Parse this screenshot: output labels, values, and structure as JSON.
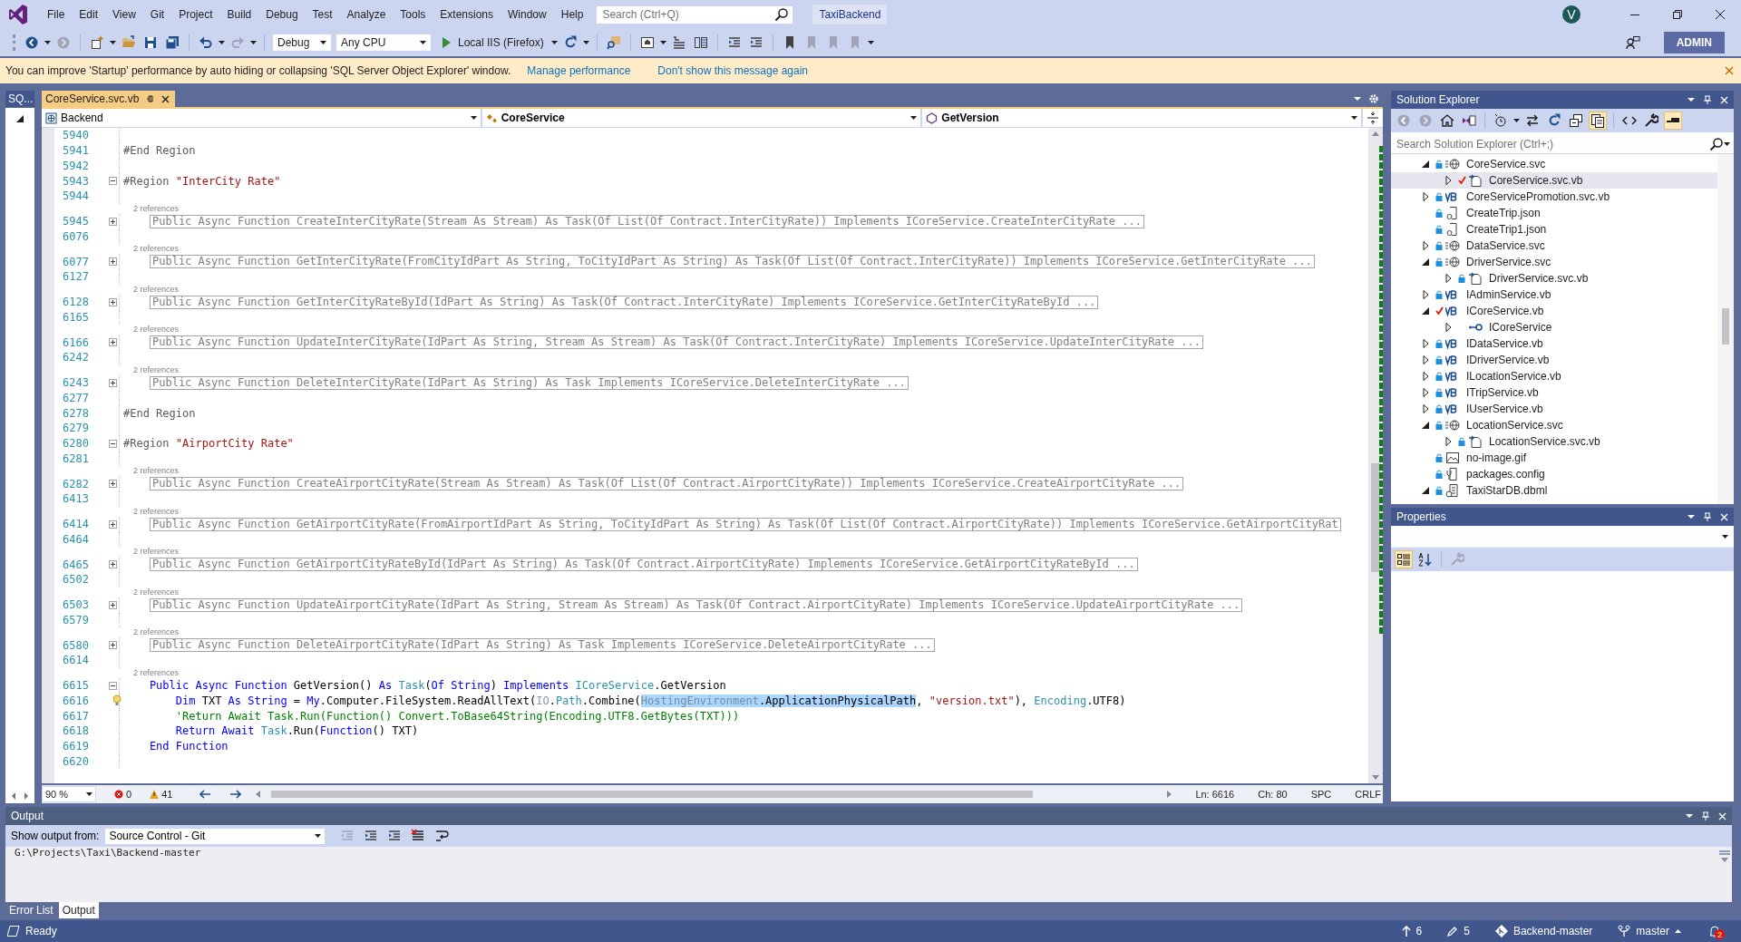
{
  "menu_bar": {
    "items": [
      "File",
      "Edit",
      "View",
      "Git",
      "Project",
      "Build",
      "Debug",
      "Test",
      "Analyze",
      "Tools",
      "Extensions",
      "Window",
      "Help"
    ],
    "search": {
      "placeholder": "Search (Ctrl+Q)"
    },
    "solution_name": "TaxiBackend",
    "account_initial": "V"
  },
  "toolbar": {
    "configuration": "Debug",
    "platform": "Any CPU",
    "run_target": "Local IIS (Firefox)",
    "account_button": "ADMIN"
  },
  "info_bar": {
    "message": "You can improve 'Startup' performance by auto hiding or collapsing 'SQL Server Object Explorer' window.",
    "links": [
      "Manage performance",
      "Don't show this message again"
    ]
  },
  "side_tab": {
    "label": "SQ..."
  },
  "document_tabs": [
    {
      "label": "CoreService.svc.vb",
      "selected": true
    }
  ],
  "navigation_bar": {
    "project": "Backend",
    "type": "CoreService",
    "member": "GetVersion"
  },
  "editor": {
    "lines": [
      {
        "number": "5940",
        "kind": "blank"
      },
      {
        "number": "5941",
        "kind": "code",
        "tokens": [
          {
            "text": "#End Region",
            "kind": "directive"
          }
        ]
      },
      {
        "number": "5942",
        "kind": "blank"
      },
      {
        "number": "5943",
        "kind": "code",
        "expanded": true,
        "tokens": [
          {
            "text": "#Region ",
            "kind": "directive"
          },
          {
            "text": "\"InterCity Rate\"",
            "kind": "string"
          }
        ]
      },
      {
        "number": "5944",
        "kind": "blank"
      },
      {
        "number": "5945",
        "kind": "collapsed",
        "expanded": false,
        "lens": "2 references",
        "text": "Public Async Function CreateInterCityRate(Stream As Stream) As Task(Of List(Of Contract.InterCityRate)) Implements ICoreService.CreateInterCityRate ..."
      },
      {
        "number": "6076",
        "kind": "blank"
      },
      {
        "number": "6077",
        "kind": "collapsed",
        "expanded": false,
        "lens": "2 references",
        "text": "Public Async Function GetInterCityRate(FromCityIdPart As String, ToCityIdPart As String) As Task(Of List(Of Contract.InterCityRate)) Implements ICoreService.GetInterCityRate ..."
      },
      {
        "number": "6127",
        "kind": "blank"
      },
      {
        "number": "6128",
        "kind": "collapsed",
        "expanded": false,
        "lens": "2 references",
        "text": "Public Async Function GetInterCityRateById(IdPart As String) As Task(Of Contract.InterCityRate) Implements ICoreService.GetInterCityRateById ..."
      },
      {
        "number": "6165",
        "kind": "blank"
      },
      {
        "number": "6166",
        "kind": "collapsed",
        "expanded": false,
        "lens": "2 references",
        "text": "Public Async Function UpdateInterCityRate(IdPart As String, Stream As Stream) As Task(Of Contract.InterCityRate) Implements ICoreService.UpdateInterCityRate ..."
      },
      {
        "number": "6242",
        "kind": "blank"
      },
      {
        "number": "6243",
        "kind": "collapsed",
        "expanded": false,
        "lens": "2 references",
        "text": "Public Async Function DeleteInterCityRate(IdPart As String) As Task Implements ICoreService.DeleteInterCityRate ..."
      },
      {
        "number": "6277",
        "kind": "blank"
      },
      {
        "number": "6278",
        "kind": "code",
        "tokens": [
          {
            "text": "#End Region",
            "kind": "directive"
          }
        ]
      },
      {
        "number": "6279",
        "kind": "blank"
      },
      {
        "number": "6280",
        "kind": "code",
        "expanded": true,
        "tokens": [
          {
            "text": "#Region ",
            "kind": "directive"
          },
          {
            "text": "\"AirportCity Rate\"",
            "kind": "string"
          }
        ]
      },
      {
        "number": "6281",
        "kind": "blank"
      },
      {
        "number": "6282",
        "kind": "collapsed",
        "expanded": false,
        "lens": "2 references",
        "text": "Public Async Function CreateAirportCityRate(Stream As Stream) As Task(Of List(Of Contract.AirportCityRate)) Implements ICoreService.CreateAirportCityRate ..."
      },
      {
        "number": "6413",
        "kind": "blank"
      },
      {
        "number": "6414",
        "kind": "collapsed",
        "expanded": false,
        "lens": "2 references",
        "text": "Public Async Function GetAirportCityRate(FromAirportIdPart As String, ToCityIdPart As String) As Task(Of List(Of Contract.AirportCityRate)) Implements ICoreService.GetAirportCityRat"
      },
      {
        "number": "6464",
        "kind": "blank"
      },
      {
        "number": "6465",
        "kind": "collapsed",
        "expanded": false,
        "lens": "2 references",
        "text": "Public Async Function GetAirportCityRateById(IdPart As String) As Task(Of Contract.AirportCityRate) Implements ICoreService.GetAirportCityRateById ..."
      },
      {
        "number": "6502",
        "kind": "blank"
      },
      {
        "number": "6503",
        "kind": "collapsed",
        "expanded": false,
        "lens": "2 references",
        "text": "Public Async Function UpdateAirportCityRate(IdPart As String, Stream As Stream) As Task(Of Contract.AirportCityRate) Implements ICoreService.UpdateAirportCityRate ..."
      },
      {
        "number": "6579",
        "kind": "blank"
      },
      {
        "number": "6580",
        "kind": "collapsed",
        "expanded": false,
        "lens": "2 references",
        "text": "Public Async Function DeleteAirportCityRate(IdPart As String) As Task Implements ICoreService.DeleteAirportCityRate ..."
      },
      {
        "number": "6614",
        "kind": "blank"
      },
      {
        "number": "6615",
        "kind": "code",
        "expanded": true,
        "lens": "2 references",
        "tokens": [
          {
            "text": "    Public Async Function",
            "kind": "keyword"
          },
          {
            "text": " GetVersion() ",
            "kind": "plain"
          },
          {
            "text": "As ",
            "kind": "keyword"
          },
          {
            "text": "Task",
            "kind": "type"
          },
          {
            "text": "(",
            "kind": "plain"
          },
          {
            "text": "Of String",
            "kind": "keyword"
          },
          {
            "text": ") ",
            "kind": "plain"
          },
          {
            "text": "Implements ",
            "kind": "keyword"
          },
          {
            "text": "ICoreService",
            "kind": "type"
          },
          {
            "text": ".GetVersion",
            "kind": "plain"
          }
        ]
      },
      {
        "number": "6616",
        "kind": "code",
        "lightbulb": true,
        "tokens": [
          {
            "text": "        Dim",
            "kind": "keyword"
          },
          {
            "text": " TXT ",
            "kind": "plain"
          },
          {
            "text": "As String",
            "kind": "keyword"
          },
          {
            "text": " = ",
            "kind": "plain"
          },
          {
            "text": "My",
            "kind": "keyword"
          },
          {
            "text": ".Computer.FileSystem.ReadAllText(",
            "kind": "plain"
          },
          {
            "text": "IO",
            "kind": "dim"
          },
          {
            "text": ".",
            "kind": "plain"
          },
          {
            "text": "Path",
            "kind": "type"
          },
          {
            "text": ".Combine(",
            "kind": "plain"
          },
          {
            "text": "HostingEnvironment",
            "kind": "selected-dim"
          },
          {
            "text": ".ApplicationPhysicalPath",
            "kind": "selected-plain"
          },
          {
            "text": ", ",
            "kind": "plain"
          },
          {
            "text": "\"version.txt\"",
            "kind": "string"
          },
          {
            "text": "), ",
            "kind": "plain"
          },
          {
            "text": "Encoding",
            "kind": "type"
          },
          {
            "text": ".UTF8)",
            "kind": "plain"
          }
        ]
      },
      {
        "number": "6617",
        "kind": "code",
        "tokens": [
          {
            "text": "        'Return Await Task.Run(Function() Convert.ToBase64String(Encoding.UTF8.GetBytes(TXT)))",
            "kind": "comment"
          }
        ]
      },
      {
        "number": "6618",
        "kind": "code",
        "tokens": [
          {
            "text": "        Return Await ",
            "kind": "keyword"
          },
          {
            "text": "Task",
            "kind": "type"
          },
          {
            "text": ".Run(",
            "kind": "plain"
          },
          {
            "text": "Function",
            "kind": "keyword"
          },
          {
            "text": "() TXT)",
            "kind": "plain"
          }
        ]
      },
      {
        "number": "6619",
        "kind": "code",
        "tokens": [
          {
            "text": "    End Function",
            "kind": "keyword"
          }
        ]
      },
      {
        "number": "6620",
        "kind": "blank"
      }
    ]
  },
  "editor_status": {
    "zoom": "90 %",
    "errors": "0",
    "warnings": "41",
    "line": "Ln: 6616",
    "column": "Ch: 80",
    "whitespace": "SPC",
    "line_ending": "CRLF"
  },
  "solution_explorer": {
    "title": "Solution Explorer",
    "search": {
      "placeholder": "Search Solution Explorer (Ctrl+;)"
    },
    "items": [
      {
        "name": "CoreService.svc",
        "kind": "service",
        "locked": true,
        "modified": false,
        "expanded": true,
        "selected": false,
        "children": [
          {
            "name": "CoreService.svc.vb",
            "kind": "code-behind",
            "locked": false,
            "modified": true,
            "expanded": false,
            "selected": true
          }
        ]
      },
      {
        "name": "CoreServicePromotion.svc.vb",
        "kind": "vb",
        "locked": true,
        "modified": false,
        "expanded": false,
        "selected": false
      },
      {
        "name": "CreateTrip.json",
        "kind": "json",
        "locked": true,
        "modified": false,
        "selected": false
      },
      {
        "name": "CreateTrip1.json",
        "kind": "json",
        "locked": true,
        "modified": false,
        "selected": false
      },
      {
        "name": "DataService.svc",
        "kind": "service",
        "locked": true,
        "modified": false,
        "expanded": false,
        "selected": false
      },
      {
        "name": "DriverService.svc",
        "kind": "service",
        "locked": true,
        "modified": false,
        "expanded": true,
        "selected": false,
        "children": [
          {
            "name": "DriverService.svc.vb",
            "kind": "code-behind",
            "locked": true,
            "modified": false,
            "expanded": false,
            "selected": false
          }
        ]
      },
      {
        "name": "IAdminService.vb",
        "kind": "vb",
        "locked": true,
        "modified": false,
        "expanded": false,
        "selected": false
      },
      {
        "name": "ICoreService.vb",
        "kind": "vb",
        "locked": false,
        "modified": true,
        "expanded": true,
        "selected": false,
        "children": [
          {
            "name": "ICoreService",
            "kind": "interface",
            "locked": false,
            "modified": false,
            "expanded": false,
            "selected": false
          }
        ]
      },
      {
        "name": "IDataService.vb",
        "kind": "vb",
        "locked": true,
        "modified": false,
        "expanded": false,
        "selected": false
      },
      {
        "name": "IDriverService.vb",
        "kind": "vb",
        "locked": true,
        "modified": false,
        "expanded": false,
        "selected": false
      },
      {
        "name": "ILocationService.vb",
        "kind": "vb",
        "locked": true,
        "modified": false,
        "expanded": false,
        "selected": false
      },
      {
        "name": "ITripService.vb",
        "kind": "vb",
        "locked": true,
        "modified": false,
        "expanded": false,
        "selected": false
      },
      {
        "name": "IUserService.vb",
        "kind": "vb",
        "locked": true,
        "modified": false,
        "expanded": false,
        "selected": false
      },
      {
        "name": "LocationService.svc",
        "kind": "service",
        "locked": true,
        "modified": false,
        "expanded": true,
        "selected": false,
        "children": [
          {
            "name": "LocationService.svc.vb",
            "kind": "code-behind",
            "locked": true,
            "modified": false,
            "expanded": false,
            "selected": false
          }
        ]
      },
      {
        "name": "no-image.gif",
        "kind": "image",
        "locked": true,
        "modified": false,
        "selected": false
      },
      {
        "name": "packages.config",
        "kind": "config",
        "locked": true,
        "modified": false,
        "selected": false
      },
      {
        "name": "TaxiStarDB.dbml",
        "kind": "dbml",
        "locked": true,
        "modified": false,
        "expanded": true,
        "selected": false
      }
    ]
  },
  "properties": {
    "title": "Properties"
  },
  "output": {
    "title": "Output",
    "source_label": "Show output from:",
    "source": "Source Control - Git",
    "text": "G:\\Projects\\Taxi\\Backend-master"
  },
  "bottom_tabs": [
    {
      "label": "Error List",
      "selected": false
    },
    {
      "label": "Output",
      "selected": true
    }
  ],
  "status_bar": {
    "message": "Ready",
    "push_count": "6",
    "changes_count": "5",
    "repository": "Backend-master",
    "branch": "master",
    "notifications": "2"
  }
}
